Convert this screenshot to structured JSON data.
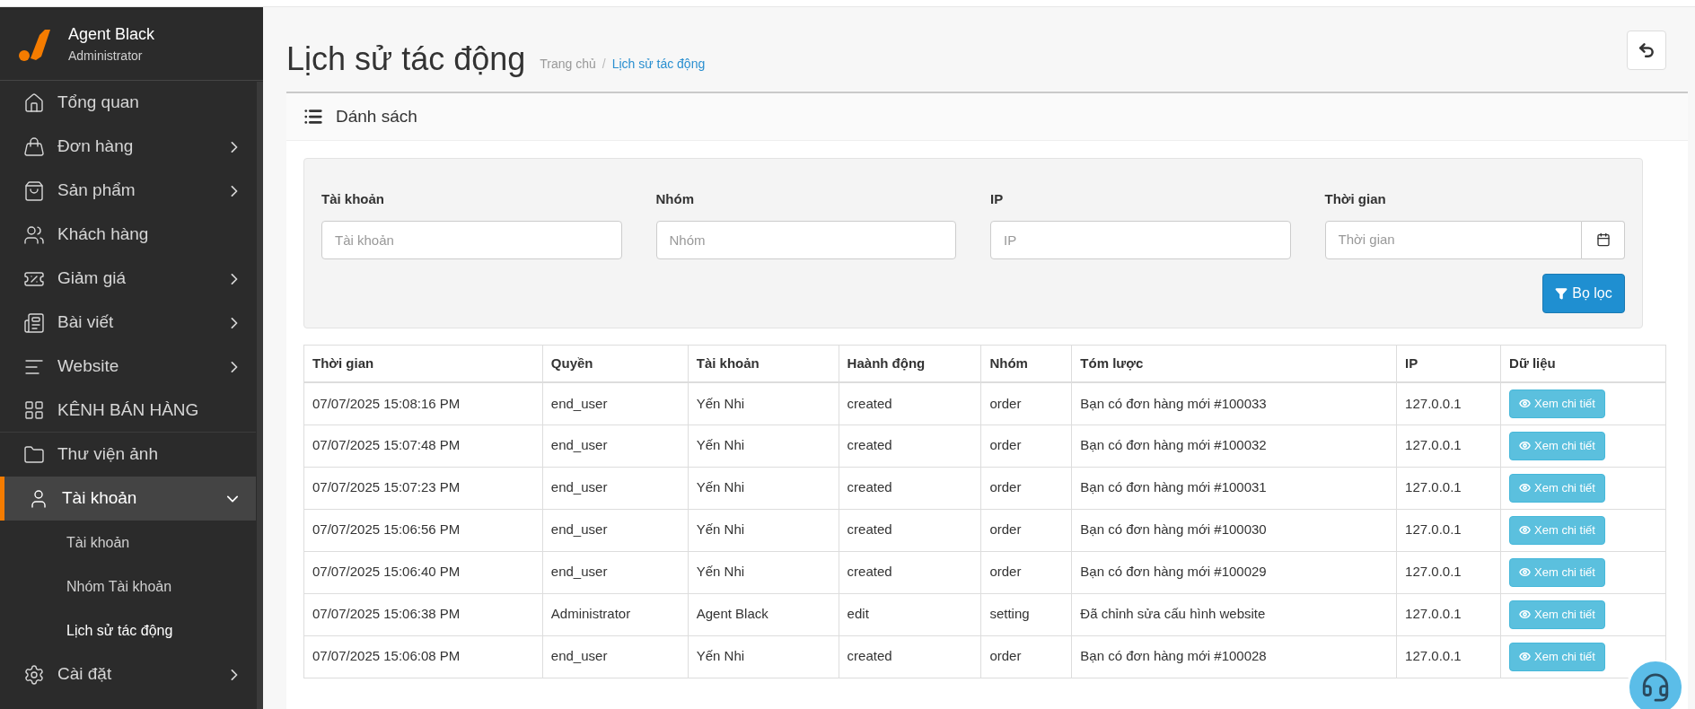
{
  "sidebar": {
    "user": {
      "name": "Agent Black",
      "role": "Administrator"
    },
    "items": [
      {
        "label": "Tổng quan",
        "kind": "home",
        "expandable": false,
        "selected": false
      },
      {
        "label": "Đơn hàng",
        "kind": "bag",
        "expandable": true,
        "expanded": false,
        "selected": false
      },
      {
        "label": "Sản phẩm",
        "kind": "shopping",
        "expandable": true,
        "expanded": false,
        "selected": false
      },
      {
        "label": "Khách hàng",
        "kind": "users",
        "expandable": false,
        "selected": false
      },
      {
        "label": "Giảm giá",
        "kind": "discount",
        "expandable": true,
        "expanded": false,
        "selected": false
      },
      {
        "label": "Bài viết",
        "kind": "article",
        "expandable": true,
        "expanded": false,
        "selected": false
      },
      {
        "label": "Website",
        "kind": "lines",
        "expandable": true,
        "expanded": false,
        "selected": false
      },
      {
        "label": "KÊNH BÁN HÀNG",
        "kind": "grid",
        "expandable": false,
        "selected": false
      },
      {
        "label": "Thư viện ảnh",
        "kind": "folder",
        "expandable": false,
        "selected": false
      },
      {
        "label": "Tài khoản",
        "kind": "user",
        "expandable": true,
        "expanded": true,
        "selected": true,
        "children": [
          {
            "label": "Tài khoản",
            "selected": false
          },
          {
            "label": "Nhóm Tài khoản",
            "selected": false
          },
          {
            "label": "Lịch sử tác động",
            "selected": true
          }
        ]
      },
      {
        "label": "Cài đặt",
        "kind": "settings",
        "expandable": true,
        "expanded": false,
        "selected": false
      }
    ]
  },
  "page": {
    "title": "Lịch sử tác động",
    "breadcrumb_separator": "/",
    "breadcrumb": [
      {
        "label": "Trang chủ",
        "selected": false
      },
      {
        "label": "Lịch sử tác động",
        "selected": true
      }
    ]
  },
  "panel": {
    "title": "Dánh sách",
    "filters": [
      {
        "label": "Tài khoản",
        "placeholder": "Tài khoản",
        "kind": "text"
      },
      {
        "label": "Nhóm",
        "placeholder": "Nhóm",
        "kind": "text"
      },
      {
        "label": "IP",
        "placeholder": "IP",
        "kind": "text"
      },
      {
        "label": "Thời gian",
        "placeholder": "Thời gian",
        "kind": "date"
      }
    ],
    "filter_button": "Bọ lọc",
    "table": {
      "columns": [
        "Thời gian",
        "Quyền",
        "Tài khoản",
        "Haành động",
        "Nhóm",
        "Tóm lược",
        "IP",
        "Dữ liệu"
      ],
      "rows": [
        {
          "cells": [
            "07/07/2025 15:08:16 PM",
            "end_user",
            "Yến Nhi",
            "created",
            "order",
            "Bạn có đơn hàng mới #100033",
            "127.0.0.1"
          ],
          "action": "Xem chi tiết"
        },
        {
          "cells": [
            "07/07/2025 15:07:48 PM",
            "end_user",
            "Yến Nhi",
            "created",
            "order",
            "Bạn có đơn hàng mới #100032",
            "127.0.0.1"
          ],
          "action": "Xem chi tiết"
        },
        {
          "cells": [
            "07/07/2025 15:07:23 PM",
            "end_user",
            "Yến Nhi",
            "created",
            "order",
            "Bạn có đơn hàng mới #100031",
            "127.0.0.1"
          ],
          "action": "Xem chi tiết"
        },
        {
          "cells": [
            "07/07/2025 15:06:56 PM",
            "end_user",
            "Yến Nhi",
            "created",
            "order",
            "Bạn có đơn hàng mới #100030",
            "127.0.0.1"
          ],
          "action": "Xem chi tiết"
        },
        {
          "cells": [
            "07/07/2025 15:06:40 PM",
            "end_user",
            "Yến Nhi",
            "created",
            "order",
            "Bạn có đơn hàng mới #100029",
            "127.0.0.1"
          ],
          "action": "Xem chi tiết"
        },
        {
          "cells": [
            "07/07/2025 15:06:38 PM",
            "Administrator",
            "Agent Black",
            "edit",
            "setting",
            "Đã chỉnh sửa cấu hình website",
            "127.0.0.1"
          ],
          "action": "Xem chi tiết"
        },
        {
          "cells": [
            "07/07/2025 15:06:08 PM",
            "end_user",
            "Yến Nhi",
            "created",
            "order",
            "Bạn có đơn hàng mới #100028",
            "127.0.0.1"
          ],
          "action": "Xem chi tiết"
        }
      ]
    }
  }
}
